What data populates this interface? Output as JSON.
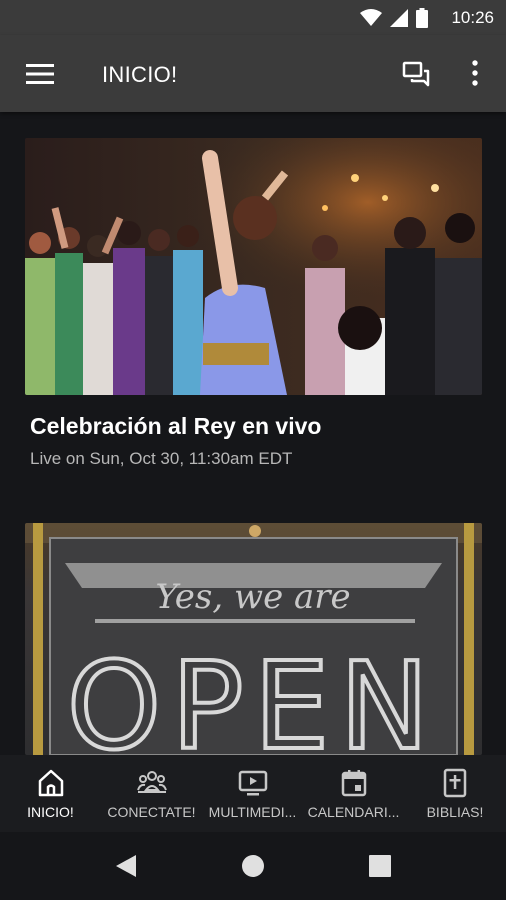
{
  "status_bar": {
    "time": "10:26"
  },
  "app_bar": {
    "title": "INICIO!"
  },
  "feed": [
    {
      "title": "Celebración al Rey en vivo",
      "subtitle": "Live on Sun, Oct 30, 11:30am EDT"
    },
    {
      "sign_line1": "Yes, we are",
      "sign_line2": "OPEN"
    }
  ],
  "bottom_nav": {
    "items": [
      {
        "label": "INICIO!",
        "icon": "home-icon"
      },
      {
        "label": "CONECTATE!",
        "icon": "group-icon"
      },
      {
        "label": "MULTIMEDI...",
        "icon": "video-icon"
      },
      {
        "label": "CALENDARI...",
        "icon": "calendar-icon"
      },
      {
        "label": "BIBLIAS!",
        "icon": "bible-icon"
      }
    ],
    "active_index": 0
  },
  "colors": {
    "app_bar": "#3b3b3b",
    "background": "#151619",
    "nav_bg": "#1b1c1f"
  }
}
